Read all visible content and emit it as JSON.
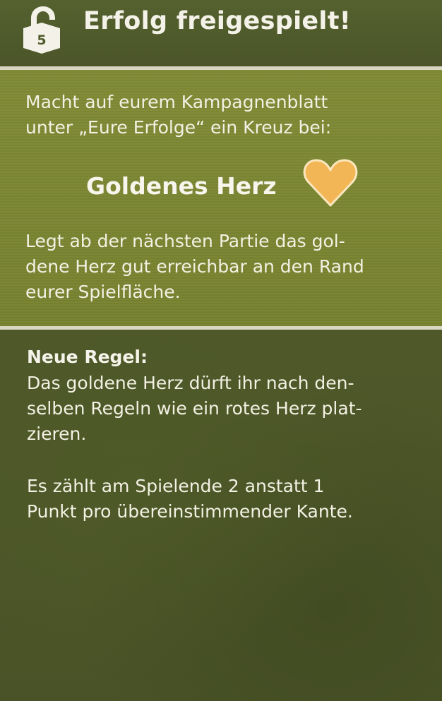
{
  "header": {
    "lock_number": "5",
    "title": "Erfolg freigespielt!"
  },
  "achievement": {
    "intro_lines": [
      "Macht auf eurem Kampagnenblatt",
      "unter „Eure Erfolge“ ein Kreuz bei:"
    ],
    "name": "Goldenes Herz",
    "icon": "golden-heart-icon",
    "description_lines": [
      "Legt ab der nächsten Partie das gol-",
      "dene Herz gut erreichbar an den Rand",
      "eurer Spielfläche."
    ]
  },
  "new_rule": {
    "label": "Neue Regel:",
    "text_lines": [
      "Das goldene Herz dürft ihr nach den-",
      "selben Regeln wie ein rotes Herz plat-",
      "zieren."
    ],
    "scoring_lines": [
      "Es zählt am Spielende 2 anstatt 1",
      "Punkt pro übereinstimmender Kante."
    ]
  },
  "colors": {
    "header_bg": "#4f5a2c",
    "light_panel": "#7b8634",
    "dark_panel": "#4c5529",
    "heart": "#f2b656",
    "text": "#f3f1e3"
  }
}
